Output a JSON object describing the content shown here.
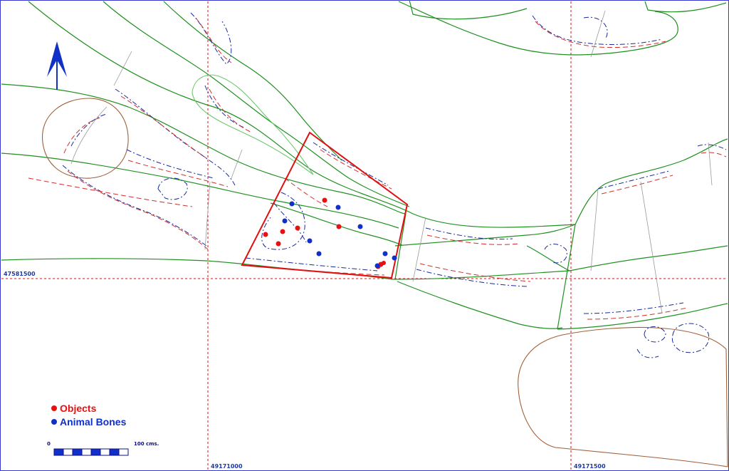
{
  "map": {
    "grid_labels": {
      "northing": "47581500",
      "easting_left": "49171000",
      "easting_right": "49171500"
    },
    "legend": {
      "objects_label": "Objects",
      "animal_bones_label": "Animal Bones",
      "objects_color": "#e81010",
      "animal_bones_color": "#1030c8"
    },
    "scale_bar": {
      "start_label": "0",
      "end_label": "100 cms."
    },
    "north_arrow": "north-arrow-icon",
    "colors": {
      "frame": "#3a3ad0",
      "grid": "#c81818",
      "excavation_area": "#e01010",
      "contour_green": "#209020",
      "contour_brown": "#a0603a"
    },
    "finds": {
      "objects_count": 9,
      "animal_bones_count": 10
    }
  }
}
